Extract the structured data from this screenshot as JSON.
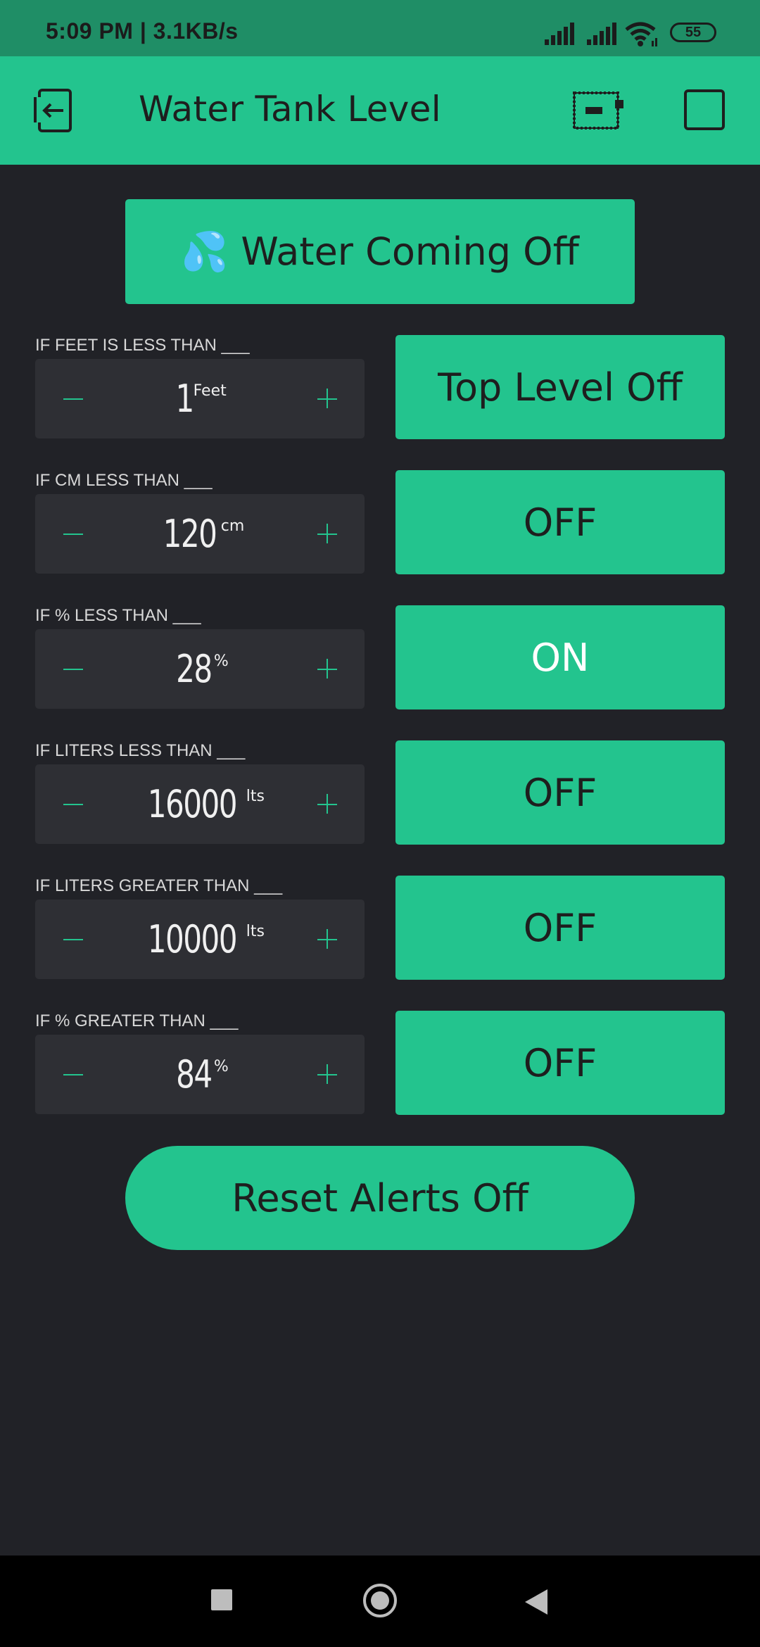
{
  "status_bar": {
    "time": "5:09 PM | 3.1KB/s",
    "battery": "55",
    "icons": [
      "signal-icon",
      "signal-icon",
      "wifi-icon",
      "battery-icon"
    ]
  },
  "app_bar": {
    "title": "Water Tank Level",
    "icons": [
      "back-icon",
      "device-icon",
      "square-icon"
    ]
  },
  "water_button": {
    "emoji": "💦",
    "label": "Water Coming Off"
  },
  "rules": [
    {
      "label": "IF FEET IS LESS THAN ___",
      "value": "1",
      "unit": "Feet",
      "toggle": "Top Level Off"
    },
    {
      "label": "IF CM LESS THAN ___",
      "value": "120",
      "unit": "cm",
      "toggle": "OFF"
    },
    {
      "label": "IF % LESS THAN ___",
      "value": "28",
      "unit": "%",
      "toggle": "ON"
    },
    {
      "label": "IF LITERS LESS THAN ___",
      "value": "16000",
      "unit": "lts",
      "toggle": "OFF"
    },
    {
      "label": "IF LITERS GREATER THAN ___",
      "value": "10000",
      "unit": "lts",
      "toggle": "OFF"
    },
    {
      "label": "IF % GREATER THAN ___",
      "value": "84",
      "unit": "%",
      "toggle": "OFF"
    }
  ],
  "reset_button": {
    "label": "Reset Alerts Off"
  },
  "colors": {
    "accent": "#23C48E",
    "background": "#212227",
    "stepper_bg": "#2E2F34"
  },
  "nav_bar": {
    "icons": [
      "recents-icon",
      "home-icon",
      "back-triangle-icon"
    ]
  }
}
